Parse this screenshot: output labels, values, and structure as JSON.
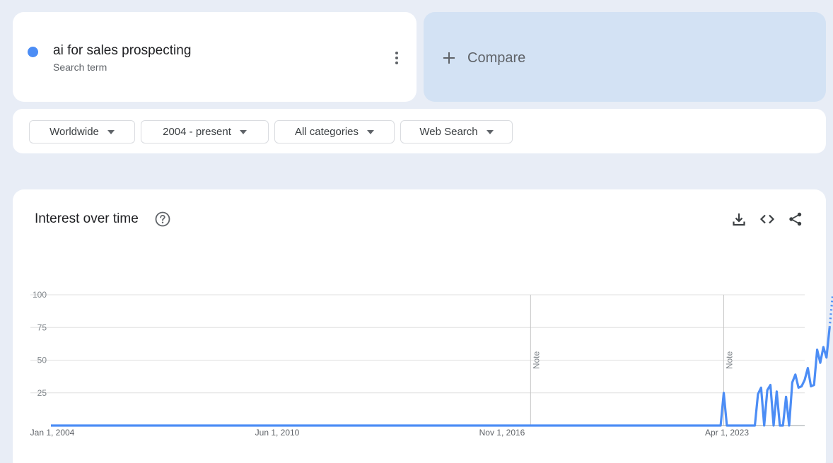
{
  "search_term": {
    "name": "ai for sales prospecting",
    "type_label": "Search term",
    "color": "#4c8df5"
  },
  "compare": {
    "label": "Compare"
  },
  "filters": [
    {
      "label": "Worldwide"
    },
    {
      "label": "2004 - present"
    },
    {
      "label": "All categories"
    },
    {
      "label": "Web Search"
    }
  ],
  "chart_panel": {
    "title": "Interest over time",
    "note_label": "Note",
    "icons": [
      "help-icon",
      "download-icon",
      "embed-code-icon",
      "share-icon"
    ]
  },
  "chart_data": {
    "type": "line",
    "title": "Interest over time",
    "xlabel": "",
    "ylabel": "",
    "ylim": [
      0,
      100
    ],
    "yticks": [
      25,
      50,
      75,
      100
    ],
    "xticks": [
      "Jan 1, 2004",
      "Jun 1, 2010",
      "Nov 1, 2016",
      "Apr 1, 2023"
    ],
    "xlim": [
      "2004-01",
      "2024-03"
    ],
    "grid": true,
    "notes": [
      "2016-11",
      "2022-01"
    ],
    "series": [
      {
        "name": "ai for sales prospecting",
        "color": "#4c8df5",
        "points": [
          [
            "2004-01",
            0
          ],
          [
            "2021-12",
            0
          ],
          [
            "2022-01",
            25
          ],
          [
            "2022-02",
            0
          ],
          [
            "2022-11",
            0
          ],
          [
            "2022-12",
            24
          ],
          [
            "2023-01",
            29
          ],
          [
            "2023-02",
            0
          ],
          [
            "2023-03",
            27
          ],
          [
            "2023-04",
            31
          ],
          [
            "2023-05",
            0
          ],
          [
            "2023-06",
            26
          ],
          [
            "2023-07",
            0
          ],
          [
            "2023-08",
            0
          ],
          [
            "2023-09",
            22
          ],
          [
            "2023-10",
            0
          ],
          [
            "2023-11",
            33
          ],
          [
            "2023-12",
            39
          ],
          [
            "2024-01",
            29
          ],
          [
            "2024-02",
            30
          ],
          [
            "2024-03",
            35
          ],
          [
            "2024-04",
            44
          ],
          [
            "2024-05",
            30
          ],
          [
            "2024-06",
            31
          ],
          [
            "2024-07",
            58
          ],
          [
            "2024-08",
            48
          ],
          [
            "2024-09",
            60
          ],
          [
            "2024-10",
            52
          ],
          [
            "2024-11",
            75
          ]
        ],
        "partial": [
          [
            "2024-11",
            75
          ],
          [
            "2024-12",
            100
          ]
        ]
      }
    ]
  }
}
